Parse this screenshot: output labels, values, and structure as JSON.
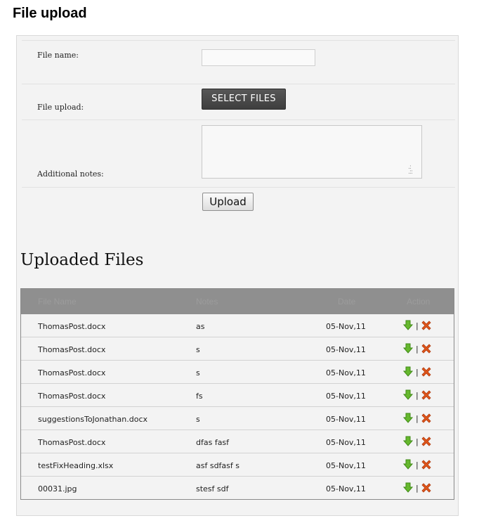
{
  "page": {
    "title": "File upload"
  },
  "form": {
    "file_name_label": "File name:",
    "file_name_value": "",
    "file_upload_label": "File upload:",
    "select_files_label": "SELECT FILES",
    "notes_label": "Additional notes:",
    "notes_value": "",
    "upload_button_label": "Upload"
  },
  "uploaded": {
    "heading": "Uploaded Files",
    "columns": {
      "name": "File Name",
      "notes": "Notes",
      "date": "Date",
      "action": "Action"
    },
    "separator": "|",
    "rows": [
      {
        "name": "ThomasPost.docx",
        "notes": "as",
        "date": "05-Nov,11"
      },
      {
        "name": "ThomasPost.docx",
        "notes": "s",
        "date": "05-Nov,11"
      },
      {
        "name": "ThomasPost.docx",
        "notes": "s",
        "date": "05-Nov,11"
      },
      {
        "name": "ThomasPost.docx",
        "notes": "fs",
        "date": "05-Nov,11"
      },
      {
        "name": "suggestionsToJonathan.docx",
        "notes": "s",
        "date": "05-Nov,11"
      },
      {
        "name": "ThomasPost.docx",
        "notes": "dfas fasf",
        "date": "05-Nov,11"
      },
      {
        "name": "testFixHeading.xlsx",
        "notes": "asf sdfasf s",
        "date": "05-Nov,11"
      },
      {
        "name": "00031.jpg",
        "notes": "stesf sdf",
        "date": "05-Nov,11"
      }
    ]
  },
  "icons": {
    "download": "download-arrow-icon",
    "delete": "delete-x-icon"
  },
  "colors": {
    "header_bg": "#8f8f8f",
    "panel_bg": "#f3f3f3",
    "select_btn": "#464646",
    "download": "#66b82e",
    "delete": "#e0561b"
  }
}
